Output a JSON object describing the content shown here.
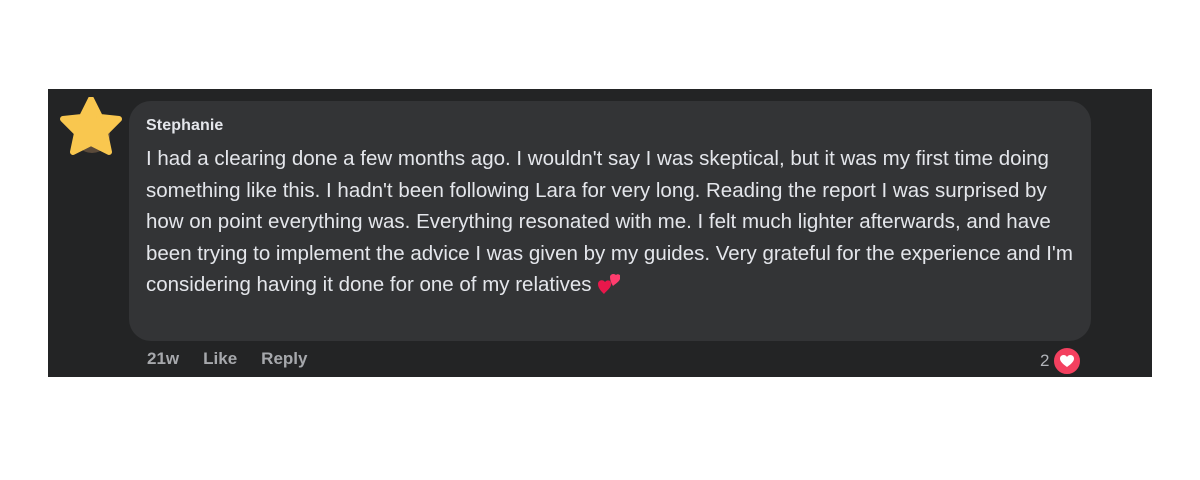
{
  "comment": {
    "author": "Stephanie",
    "text": "I had a clearing done a few months ago. I wouldn't say I was skeptical, but it was my first time doing something like this. I hadn't been following Lara for very long. Reading the report I was surprised by how on point everything was. Everything resonated with me. I felt much lighter afterwards, and have been trying to implement the advice I was given by my guides. Very grateful for the experience and I'm considering having it done for one of my relatives",
    "emoji": "two-hearts-icon",
    "avatar_icon": "star-icon"
  },
  "actions": {
    "time": "21w",
    "like_label": "Like",
    "reply_label": "Reply"
  },
  "reactions": {
    "count": "2",
    "icon": "heart-icon"
  },
  "colors": {
    "background": "#232425",
    "bubble": "#333436",
    "text": "#e4e6eb",
    "muted": "#a6a8ac",
    "heart": "#f3405f",
    "star": "#f9c74f"
  }
}
